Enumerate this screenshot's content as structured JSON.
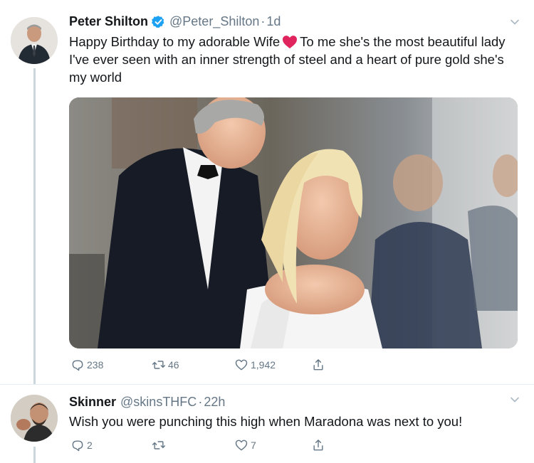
{
  "tweets": [
    {
      "author_name": "Peter Shilton",
      "handle": "@Peter_Shilton",
      "separator": "·",
      "time": "1d",
      "verified": true,
      "avatar_icon": "person-avatar",
      "text_before_emoji": "Happy Birthday to my adorable Wife",
      "emoji": "red-heart-icon",
      "text_after_emoji": "To me she's the most beautiful lady I've ever seen with an inner strength of steel and a heart of pure gold she's my world",
      "has_photo": true,
      "actions": {
        "replies": "238",
        "retweets": "46",
        "likes": "1,942"
      }
    },
    {
      "author_name": "Skinner",
      "handle": "@skinsTHFC",
      "separator": "·",
      "time": "22h",
      "verified": false,
      "avatar_icon": "person-avatar",
      "text": "Wish you were punching this high when Maradona was next to you!",
      "actions": {
        "replies": "2",
        "retweets": "",
        "likes": "7"
      }
    }
  ],
  "colors": {
    "text": "#14171a",
    "muted": "#657786",
    "verified_blue": "#1da1f2",
    "heart_red": "#e0245e",
    "thread_line": "#ccd6dd"
  }
}
